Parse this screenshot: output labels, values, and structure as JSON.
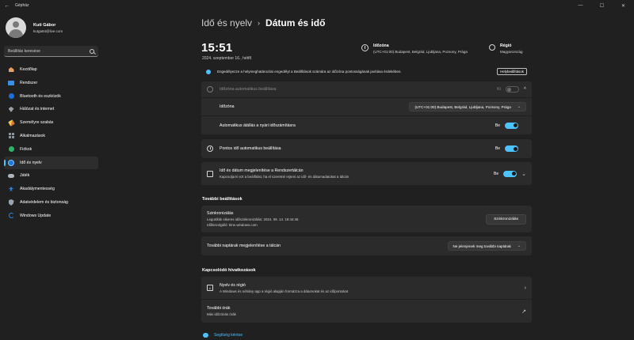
{
  "window": {
    "title": "Gépház",
    "back_glyph": "←",
    "minimize_glyph": "—",
    "maximize_glyph": "☐",
    "close_glyph": "✕"
  },
  "profile": {
    "name": "Kuti Gábor",
    "email": "kutga84@live.com"
  },
  "search": {
    "placeholder": "Beállítás keresése"
  },
  "nav": {
    "items": [
      {
        "label": "Kezdőlap",
        "icon": "home-icon"
      },
      {
        "label": "Rendszer",
        "icon": "system-icon"
      },
      {
        "label": "Bluetooth és eszközök",
        "icon": "bluetooth-icon"
      },
      {
        "label": "Hálózat és internet",
        "icon": "network-icon"
      },
      {
        "label": "Személyre szabás",
        "icon": "brush-icon"
      },
      {
        "label": "Alkalmazások",
        "icon": "apps-icon"
      },
      {
        "label": "Fiókok",
        "icon": "accounts-icon"
      },
      {
        "label": "Idő és nyelv",
        "icon": "time-language-icon",
        "active": true
      },
      {
        "label": "Játék",
        "icon": "gaming-icon"
      },
      {
        "label": "Akadálymentesség",
        "icon": "accessibility-icon"
      },
      {
        "label": "Adatvédelem és biztonság",
        "icon": "shield-icon"
      },
      {
        "label": "Windows Update",
        "icon": "update-icon"
      }
    ]
  },
  "header": {
    "parent": "Idő és nyelv",
    "separator": "›",
    "current": "Dátum és idő"
  },
  "clock": {
    "time": "15:51",
    "date": "2024. szeptember 16., hétfő"
  },
  "timezone_summary": {
    "title": "Időzóna",
    "value": "(UTC+01:00) Budapest, Belgrád, Ljubljana, Pozsony, Prága"
  },
  "region_summary": {
    "title": "Régió",
    "value": "Magyarország"
  },
  "info_bar": {
    "text": "Engedélyezze a helymeghatározási engedélyt a Beállítások számára az időzóna pontosságának javítása érdekében.",
    "button": "Helybeállítások"
  },
  "auto_tz": {
    "label": "Időzóna automatikus beállítása",
    "toggle_state": "Ki",
    "chevron": "^"
  },
  "timezone_row": {
    "label": "Időzóna",
    "value": "(UTC+01:00) Budapest, Belgrád, Ljubljana, Pozsony, Prága",
    "caret": "⌄"
  },
  "dst_row": {
    "label": "Automatikus átállás a nyári időszámításra",
    "toggle_state": "Be"
  },
  "auto_time_row": {
    "label": "Pontos idő automatikus beállítása",
    "toggle_state": "Be"
  },
  "taskbar_row": {
    "label": "Idő és dátum megjelenítése a Rendszertálcán",
    "sub": "Kapcsolja ki ezt a beállítást, ha el szeretné rejteni az idő- és dátumadatokat a tálcán",
    "toggle_state": "Be",
    "chevron": "⌄"
  },
  "more_settings": {
    "title": "További beállítások",
    "sync_title": "Szinkronizálás",
    "sync_last": "Legutóbbi sikeres időszinkronizálás: 2024. 09. 14. 18:44:46",
    "sync_server": "Időkiszolgáló: time.windows.com",
    "sync_button": "Szinkronizálás",
    "calendars_label": "További naptárak megjelenítése a tálcán",
    "calendars_value": "Ne jelenjenek meg további naptárak",
    "calendars_caret": "⌄"
  },
  "related": {
    "title": "Kapcsolódó hivatkozások",
    "lang_title": "Nyelv és régió",
    "lang_sub": "A Windows és néhány app a régió alapján formázza a dátumokat és az időpontokat",
    "lang_chevron": "›",
    "clocks_title": "További órák",
    "clocks_sub": "Más időzónás órák",
    "clocks_icon": "↗"
  },
  "help": {
    "label": "Segítség kérése"
  },
  "colors": {
    "accent": "#4cc2ff",
    "background": "#202020",
    "card": "#2b2b2b"
  }
}
